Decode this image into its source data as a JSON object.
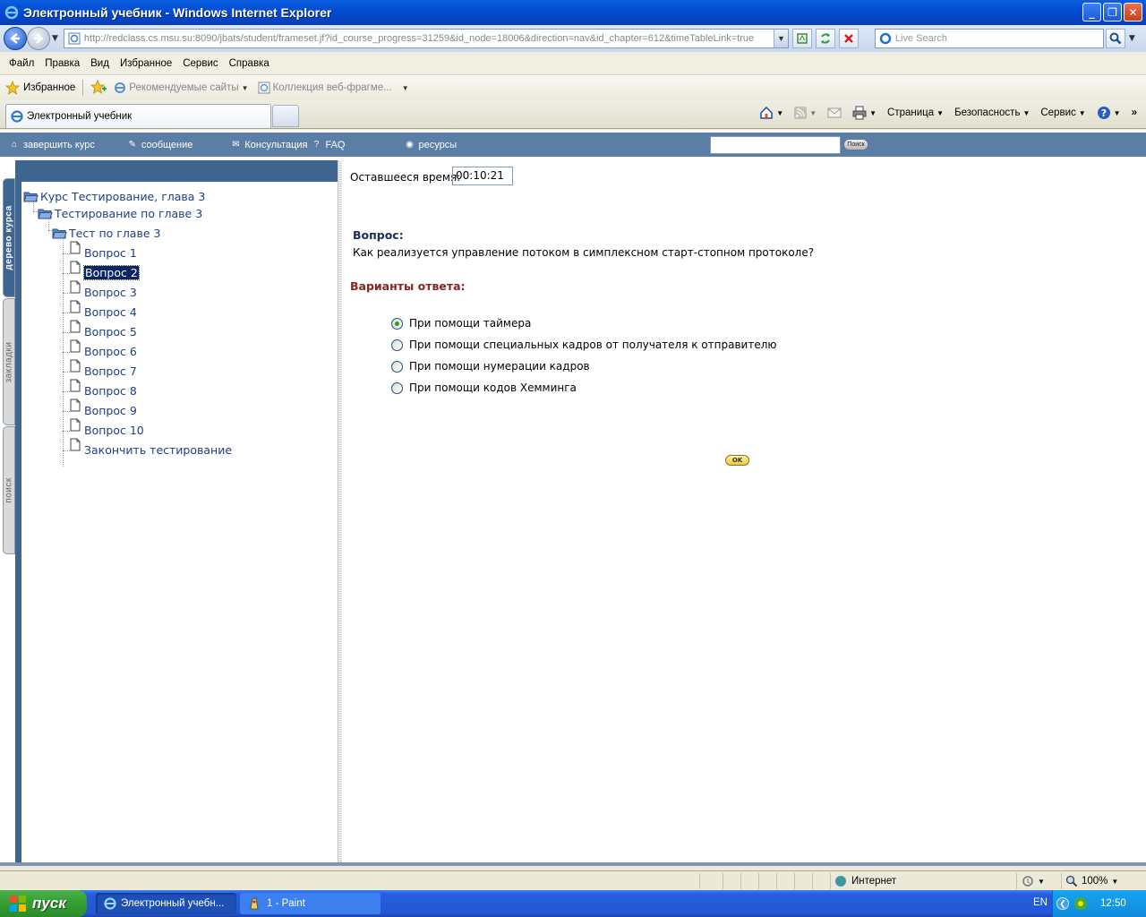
{
  "window": {
    "title": "Электронный учебник - Windows Internet Explorer",
    "minimize_label": "_",
    "restore_label": "❐",
    "close_label": "✕"
  },
  "address": {
    "url": "http://redclass.cs.msu.su:8090/jbats/student/frameset.jf?id_course_progress=31259&id_node=18006&direction=nav&id_chapter=612&timeTableLink=true",
    "search_placeholder": "Live Search"
  },
  "menu": [
    "Файл",
    "Правка",
    "Вид",
    "Избранное",
    "Сервис",
    "Справка"
  ],
  "favorites": {
    "favorites_label": "Избранное",
    "suggested_sites": "Рекомендуемые сайты",
    "web_slices": "Коллекция веб-фрагме..."
  },
  "tab": {
    "title": "Электронный учебник"
  },
  "command_bar": {
    "page": "Страница",
    "safety": "Безопасность",
    "tools": "Сервис"
  },
  "site_nav": {
    "finish_course": "завершить курс",
    "message": "сообщение",
    "consult": "Консультация",
    "faq": "FAQ",
    "resources": "ресурсы",
    "search_button": "Поиск"
  },
  "side_tabs": {
    "tree": "дерево курса",
    "bookmarks": "закладки",
    "search": "поиск"
  },
  "tree": {
    "course": "Курс Тестирование, глава 3",
    "section": "Тестирование по главе 3",
    "test": "Тест по главе 3",
    "items": [
      "Вопрос 1",
      "Вопрос 2",
      "Вопрос 3",
      "Вопрос 4",
      "Вопрос 5",
      "Вопрос 6",
      "Вопрос 7",
      "Вопрос 8",
      "Вопрос 9",
      "Вопрос 10",
      "Закончить тестирование"
    ],
    "selected_index": 1
  },
  "quiz": {
    "time_label": "Оставшееся время:",
    "time_value": "00:10:21",
    "question_heading": "Вопрос:",
    "question_text": "Как реализуется управление потоком в симплексном старт-стопном протоколе?",
    "answers_heading": "Варианты ответа:",
    "answers": [
      "При помощи таймера",
      "При помощи специальных кадров от получателя к отправителю",
      "При помощи нумерации кадров",
      "При помощи кодов Хемминга"
    ],
    "selected_answer_index": 0,
    "ok_label": "OK"
  },
  "status": {
    "zone": "Интернет",
    "zoom": "100%"
  },
  "taskbar": {
    "start": "пуск",
    "items": [
      "Электронный учебн...",
      "1 - Paint"
    ],
    "lang": "EN",
    "clock": "12:50"
  }
}
